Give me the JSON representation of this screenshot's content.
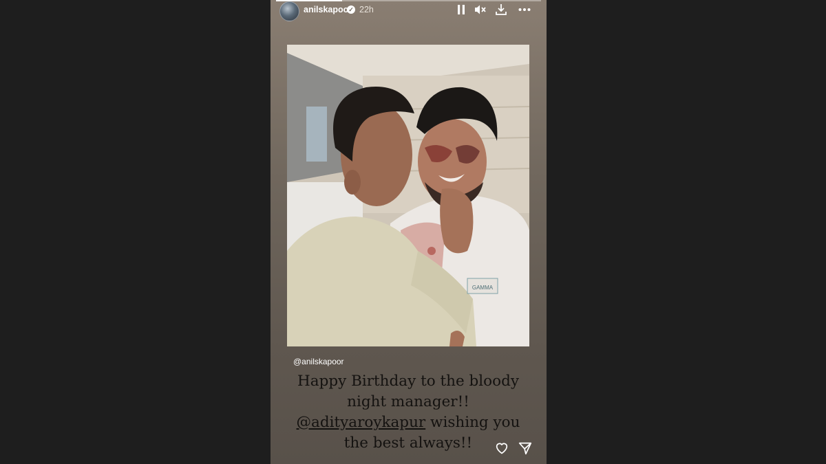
{
  "story": {
    "progress_fraction": 0.25,
    "header": {
      "username": "anilskapoor",
      "verified_icon": "verified-badge-icon",
      "time": "22h",
      "controls": [
        "pause-icon",
        "mute-icon",
        "download-icon",
        "more-icon"
      ]
    },
    "photo": {
      "text_on_jacket": "GAMMA"
    },
    "mention": "@anilskapoor",
    "caption": {
      "line1": "Happy Birthday to the bloody",
      "line2": "night manager!!",
      "tag": "@adityaroykapur",
      "line3_rest": " wishing you",
      "line4": "the best always!!"
    },
    "actions": [
      "heart-icon",
      "send-icon"
    ]
  }
}
